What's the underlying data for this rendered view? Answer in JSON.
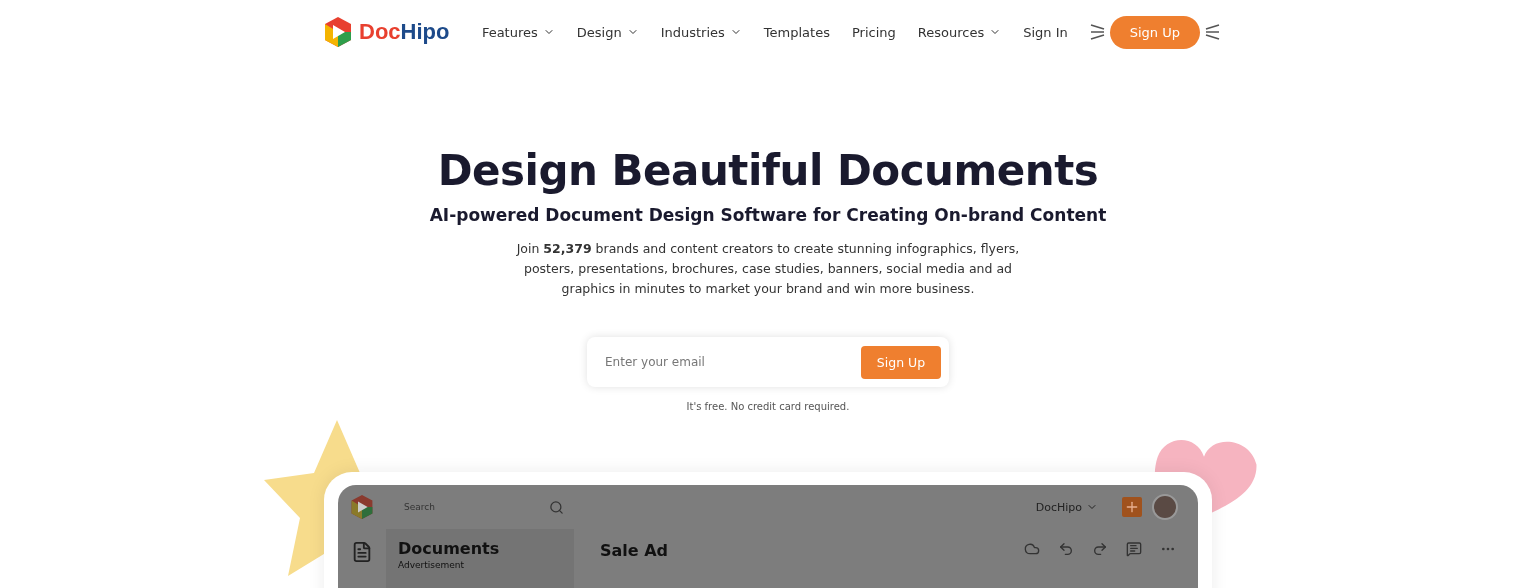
{
  "logo": {
    "parts": [
      {
        "text": "Doc",
        "color": "#e8402f"
      },
      {
        "text": "Hipo",
        "color": "#1d4a8a"
      }
    ]
  },
  "nav": [
    {
      "label": "Features",
      "dropdown": true
    },
    {
      "label": "Design",
      "dropdown": true
    },
    {
      "label": "Industries",
      "dropdown": true
    },
    {
      "label": "Templates",
      "dropdown": false
    },
    {
      "label": "Pricing",
      "dropdown": false
    },
    {
      "label": "Resources",
      "dropdown": true
    },
    {
      "label": "Sign In",
      "dropdown": false
    }
  ],
  "nav_cta": "Sign Up",
  "hero": {
    "title": "Design Beautiful Documents",
    "subtitle": "AI-powered Document Design Software for Creating On-brand Content",
    "text": "Join **52,379** brands and content creators to create stunning infographics, flyers, posters, presentations, brochures, case studies, banners, social media and ad graphics in minutes to market your brand and win more business."
  },
  "signup": {
    "placeholder": "Enter your email",
    "button": "Sign Up",
    "note": "It's free. No credit card required."
  },
  "preview": {
    "search_placeholder": "Search",
    "account": "DocHipo",
    "sidebar_title": "Documents",
    "sidebar_subtitle": "Advertisement",
    "doc_title": "Sale Ad"
  }
}
